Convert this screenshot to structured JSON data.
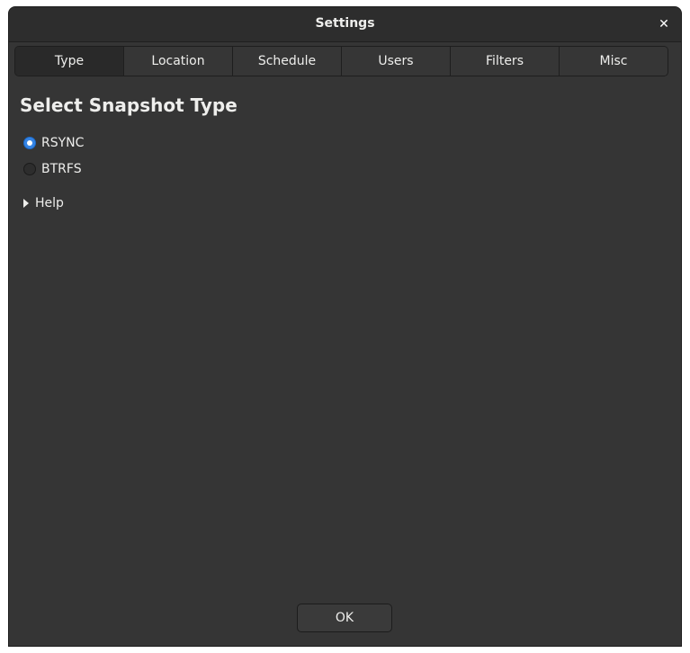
{
  "window": {
    "title": "Settings",
    "close_icon": "close-icon"
  },
  "tabs": [
    {
      "label": "Type",
      "active": true
    },
    {
      "label": "Location",
      "active": false
    },
    {
      "label": "Schedule",
      "active": false
    },
    {
      "label": "Users",
      "active": false
    },
    {
      "label": "Filters",
      "active": false
    },
    {
      "label": "Misc",
      "active": false
    }
  ],
  "content": {
    "heading": "Select Snapshot Type",
    "options": [
      {
        "label": "RSYNC",
        "selected": true
      },
      {
        "label": "BTRFS",
        "selected": false
      }
    ],
    "help_label": "Help"
  },
  "footer": {
    "ok_label": "OK"
  },
  "colors": {
    "window_bg": "#353535",
    "accent": "#3584e4"
  }
}
